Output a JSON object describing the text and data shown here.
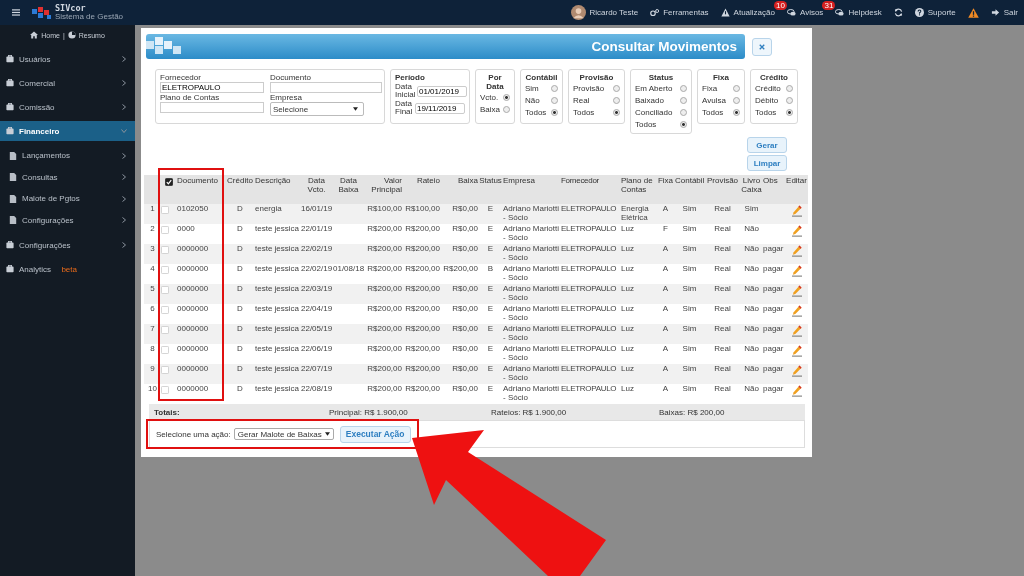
{
  "topbar": {
    "brand": "SIVcor",
    "tagline": "Sistema de Gestão",
    "user": "Ricardo Teste",
    "links": [
      {
        "label": "Ferramentas"
      },
      {
        "label": "Atualização",
        "badge": "10"
      },
      {
        "label": "Avisos",
        "badge": "31"
      },
      {
        "label": "Helpdesk"
      }
    ],
    "support": "Suporte",
    "logout": "Sair"
  },
  "sidebar": {
    "home": "Home",
    "separator": "|",
    "summary": "Resumo",
    "items": [
      {
        "label": "Usuários",
        "selected": false
      },
      {
        "label": "Comercial",
        "selected": false
      },
      {
        "label": "Comissão",
        "selected": false
      },
      {
        "label": "Financeiro",
        "selected": true,
        "expanded": true,
        "children": [
          {
            "label": "Lançamentos"
          },
          {
            "label": "Consultas"
          },
          {
            "label": "Malote de Pgtos"
          },
          {
            "label": "Configurações"
          }
        ]
      },
      {
        "label": "Configurações",
        "selected": false
      },
      {
        "label": "Analytics",
        "selected": false,
        "badge": "beta"
      }
    ]
  },
  "modal": {
    "title": "Consultar Movimentos",
    "filters": {
      "fornecedor": {
        "label": "Fornecedor",
        "value": "ELETROPAULO"
      },
      "documento": {
        "label": "Documento"
      },
      "plano": {
        "label": "Plano de Contas"
      },
      "empresa": {
        "label": "Empresa",
        "value": "Selecione"
      }
    },
    "period": {
      "title": "Período",
      "start_label": "Data Inicial",
      "start": "01/01/2019",
      "end_label": "Data Final",
      "end": "19/11/2019"
    },
    "radio_groups": [
      {
        "title": "Por Data",
        "options": [
          {
            "label": "Vcto.",
            "selected": true
          },
          {
            "label": "Baixa",
            "selected": false
          }
        ]
      },
      {
        "title": "Contábil",
        "options": [
          {
            "label": "Sim",
            "selected": false
          },
          {
            "label": "Não",
            "selected": false
          },
          {
            "label": "Todos",
            "selected": true
          }
        ]
      },
      {
        "title": "Provisão",
        "options": [
          {
            "label": "Provisão",
            "selected": false
          },
          {
            "label": "Real",
            "selected": false
          },
          {
            "label": "Todos",
            "selected": true
          }
        ]
      },
      {
        "title": "Status",
        "options": [
          {
            "label": "Em Aberto",
            "selected": false
          },
          {
            "label": "Baixado",
            "selected": false
          },
          {
            "label": "Conciliado",
            "selected": false
          },
          {
            "label": "Todos",
            "selected": true
          }
        ]
      },
      {
        "title": "Fixa",
        "options": [
          {
            "label": "Fixa",
            "selected": false
          },
          {
            "label": "Avulsa",
            "selected": false
          },
          {
            "label": "Todos",
            "selected": true
          }
        ]
      },
      {
        "title": "Crédito",
        "options": [
          {
            "label": "Crédito",
            "selected": false
          },
          {
            "label": "Débito",
            "selected": false
          },
          {
            "label": "Todos",
            "selected": true
          }
        ]
      }
    ],
    "buttons": [
      "Gerar",
      "Limpar"
    ],
    "table": {
      "all_checked": true,
      "columns": [
        "Documento",
        "Crédito",
        "Descrição",
        "Data Vcto.",
        "Data Baixa",
        "Valor Principal",
        "Rateio",
        "Baixa",
        "Status",
        "Empresa",
        "Fornecedor",
        "Plano de Contas",
        "Fixa",
        "Contábil",
        "Provisão",
        "Livro Caixa",
        "Obs",
        "Editar"
      ],
      "rows": [
        {
          "number": "1",
          "checked": false,
          "cells": [
            "0102050",
            "D",
            "energia",
            "16/01/19",
            null,
            "R$100,00",
            "R$100,00",
            "R$0,00",
            "E",
            "Adriano Mariotti - Sócio",
            "ELETROPAULO",
            "Energia Elétrica",
            "A",
            "Sim",
            "Real",
            "Sim",
            null
          ]
        },
        {
          "number": "2",
          "checked": false,
          "cells": [
            "0000",
            "D",
            "teste jessica",
            "22/01/19",
            null,
            "R$200,00",
            "R$200,00",
            "R$0,00",
            "E",
            "Adriano Mariotti - Sócio",
            "ELETROPAULO",
            "Luz",
            "F",
            "Sim",
            "Real",
            "Não",
            null
          ]
        },
        {
          "number": "3",
          "checked": false,
          "cells": [
            "0000000",
            "D",
            "teste jessica",
            "22/02/19",
            null,
            "R$200,00",
            "R$200,00",
            "R$0,00",
            "E",
            "Adriano Mariotti - Sócio",
            "ELETROPAULO",
            "Luz",
            "A",
            "Sim",
            "Real",
            "Não",
            "pagar"
          ]
        },
        {
          "number": "4",
          "checked": false,
          "cells": [
            "0000000",
            "D",
            "teste jessica",
            "22/02/19",
            "01/08/18",
            "R$200,00",
            "R$200,00",
            "R$200,00",
            "B",
            "Adriano Mariotti - Sócio",
            "ELETROPAULO",
            "Luz",
            "A",
            "Sim",
            "Real",
            "Não",
            "pagar"
          ]
        },
        {
          "number": "5",
          "checked": false,
          "cells": [
            "0000000",
            "D",
            "teste jessica",
            "22/03/19",
            null,
            "R$200,00",
            "R$200,00",
            "R$0,00",
            "E",
            "Adriano Mariotti - Sócio",
            "ELETROPAULO",
            "Luz",
            "A",
            "Sim",
            "Real",
            "Não",
            "pagar"
          ]
        },
        {
          "number": "6",
          "checked": false,
          "cells": [
            "0000000",
            "D",
            "teste jessica",
            "22/04/19",
            null,
            "R$200,00",
            "R$200,00",
            "R$0,00",
            "E",
            "Adriano Mariotti - Sócio",
            "ELETROPAULO",
            "Luz",
            "A",
            "Sim",
            "Real",
            "Não",
            "pagar"
          ]
        },
        {
          "number": "7",
          "checked": false,
          "cells": [
            "0000000",
            "D",
            "teste jessica",
            "22/05/19",
            null,
            "R$200,00",
            "R$200,00",
            "R$0,00",
            "E",
            "Adriano Mariotti - Sócio",
            "ELETROPAULO",
            "Luz",
            "A",
            "Sim",
            "Real",
            "Não",
            "pagar"
          ]
        },
        {
          "number": "8",
          "checked": false,
          "cells": [
            "0000000",
            "D",
            "teste jessica",
            "22/06/19",
            null,
            "R$200,00",
            "R$200,00",
            "R$0,00",
            "E",
            "Adriano Mariotti - Sócio",
            "ELETROPAULO",
            "Luz",
            "A",
            "Sim",
            "Real",
            "Não",
            "pagar"
          ]
        },
        {
          "number": "9",
          "checked": false,
          "cells": [
            "0000000",
            "D",
            "teste jessica",
            "22/07/19",
            null,
            "R$200,00",
            "R$200,00",
            "R$0,00",
            "E",
            "Adriano Mariotti - Sócio",
            "ELETROPAULO",
            "Luz",
            "A",
            "Sim",
            "Real",
            "Não",
            "pagar"
          ]
        },
        {
          "number": "10",
          "checked": false,
          "cells": [
            "0000000",
            "D",
            "teste jessica",
            "22/08/19",
            null,
            "R$200,00",
            "R$200,00",
            "R$0,00",
            "E",
            "Adriano Mariotti - Sócio",
            "ELETROPAULO",
            "Luz",
            "A",
            "Sim",
            "Real",
            "Não",
            "pagar"
          ]
        }
      ],
      "totals": {
        "label": "Totais:",
        "principal": "Principal: R$ 1.900,00",
        "rateios": "Rateios: R$ 1.900,00",
        "baixas": "Baixas: R$ 200,00"
      }
    },
    "action": {
      "label": "Selecione uma ação:",
      "value": "Gerar Malote de Baixas",
      "button": "Executar Ação"
    }
  }
}
